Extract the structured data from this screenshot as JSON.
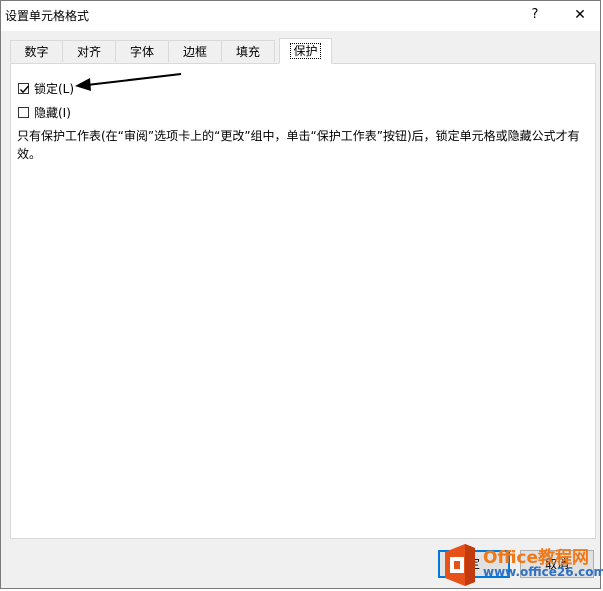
{
  "window": {
    "title": "设置单元格格式",
    "help": "?",
    "close": "✕"
  },
  "tabs": [
    {
      "label": "数字"
    },
    {
      "label": "对齐"
    },
    {
      "label": "字体"
    },
    {
      "label": "边框"
    },
    {
      "label": "填充"
    },
    {
      "label": "保护",
      "active": true
    }
  ],
  "protection": {
    "locked": {
      "label": "锁定(L)",
      "checked": true
    },
    "hidden": {
      "label": "隐藏(I)",
      "checked": false
    },
    "note": "只有保护工作表(在“审阅”选项卡上的“更改”组中，单击“保护工作表”按钮)后，锁定单元格或隐藏公式才有效。"
  },
  "buttons": {
    "ok": "定",
    "cancel": "取消"
  },
  "watermark": {
    "logo_icon": "office-logo-icon",
    "title": "Office教程网",
    "url": "www.office26.com",
    "color_orange": "#f07818",
    "color_blue": "#2f6fc4"
  },
  "annotation": {
    "icon": "arrow-left-icon"
  }
}
